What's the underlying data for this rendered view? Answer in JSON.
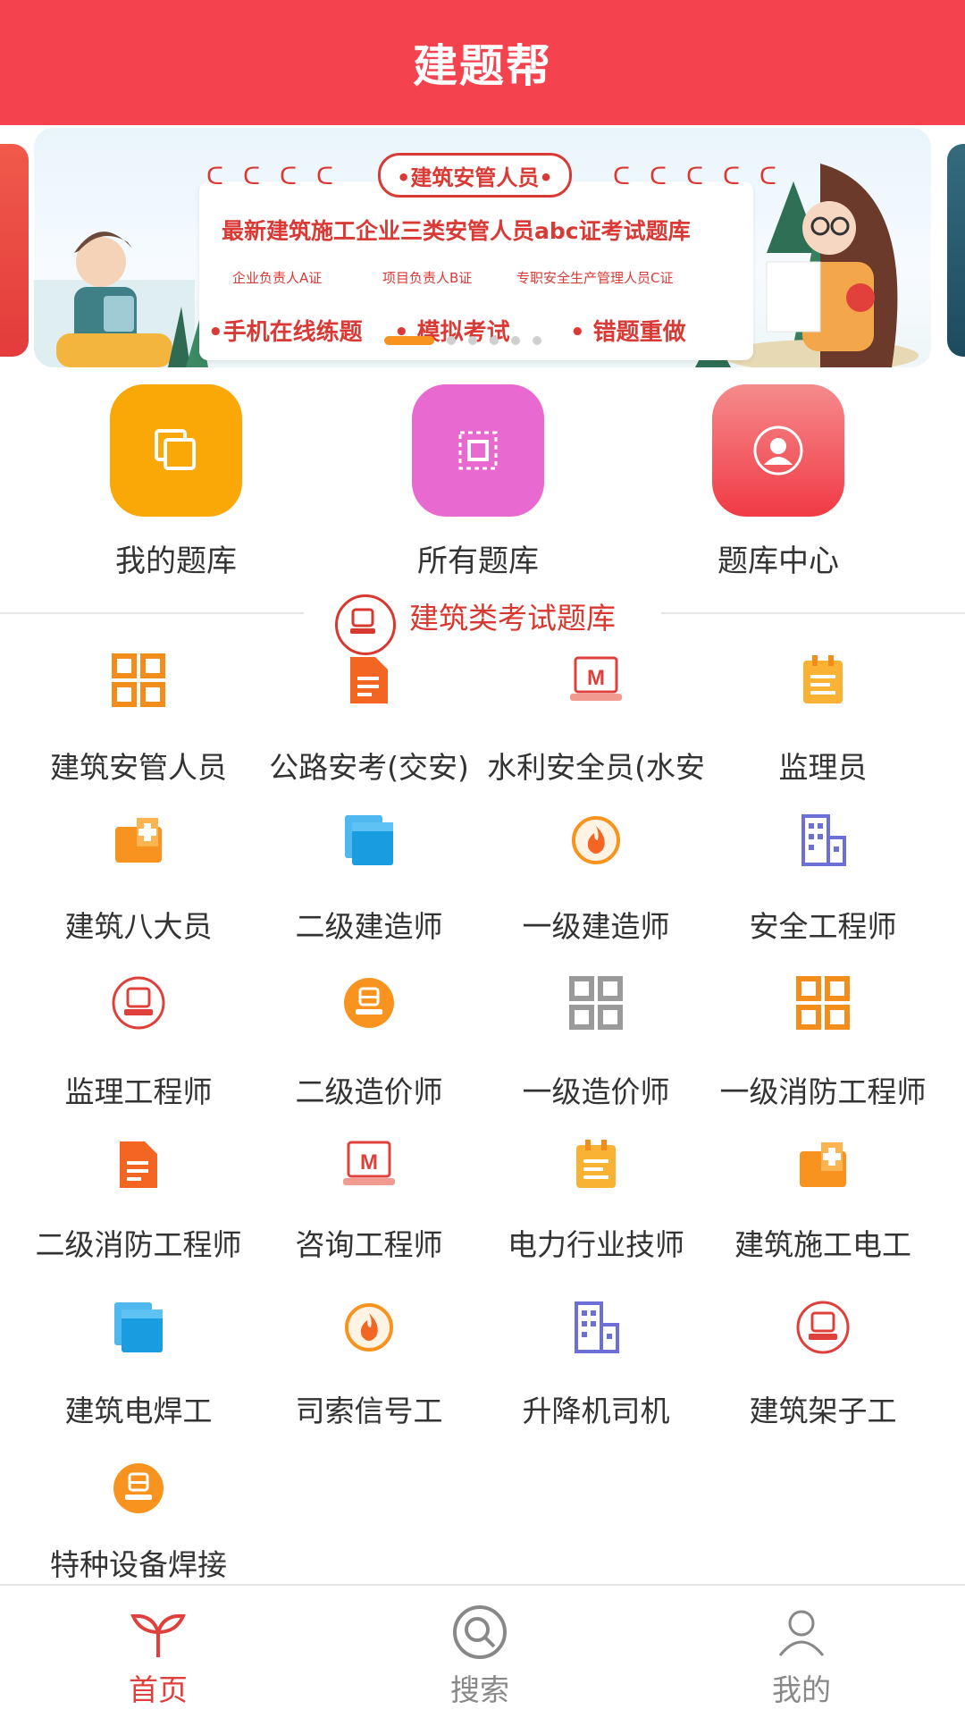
{
  "header": {
    "title": "建题帮"
  },
  "banner": {
    "ribbon": "•建筑安管人员•",
    "title": "最新建筑施工企业三类安管人员abc证考试题库",
    "subs": [
      "企业负责人A证",
      "项目负责人B证",
      "专职安全生产管理人员C证"
    ],
    "features": [
      "•手机在线练题",
      "• 模拟考试",
      "• 错题重做"
    ],
    "active_slide": 1,
    "slide_count": 6
  },
  "quick": [
    {
      "label": "我的题库",
      "icon": "copy-icon",
      "color": "#f9a807"
    },
    {
      "label": "所有题库",
      "icon": "frame-icon",
      "color": "#e86ad0"
    },
    {
      "label": "题库中心",
      "icon": "user-circle-icon",
      "color": "#f3575b"
    }
  ],
  "section": {
    "title": "建筑类考试题库"
  },
  "items": [
    {
      "label": "建筑安管人员",
      "icon": "grid-icon"
    },
    {
      "label": "公路安考(交安)",
      "icon": "document-icon"
    },
    {
      "label": "水利安全员(水安",
      "icon": "certificate-icon"
    },
    {
      "label": "监理员",
      "icon": "clipboard-icon"
    },
    {
      "label": "建筑八大员",
      "icon": "medical-kit-icon"
    },
    {
      "label": "二级建造师",
      "icon": "files-icon"
    },
    {
      "label": "一级建造师",
      "icon": "fire-icon"
    },
    {
      "label": "安全工程师",
      "icon": "building-icon"
    },
    {
      "label": "监理工程师",
      "icon": "badge-icon"
    },
    {
      "label": "二级造价师",
      "icon": "coin-icon"
    },
    {
      "label": "一级造价师",
      "icon": "grid-icon"
    },
    {
      "label": "一级消防工程师",
      "icon": "grid-icon"
    },
    {
      "label": "二级消防工程师",
      "icon": "document-icon"
    },
    {
      "label": "咨询工程师",
      "icon": "certificate-icon"
    },
    {
      "label": "电力行业技师",
      "icon": "clipboard-icon"
    },
    {
      "label": "建筑施工电工",
      "icon": "medical-kit-icon"
    },
    {
      "label": "建筑电焊工",
      "icon": "files-icon"
    },
    {
      "label": "司索信号工",
      "icon": "fire-icon"
    },
    {
      "label": "升降机司机",
      "icon": "building-icon"
    },
    {
      "label": "建筑架子工",
      "icon": "badge-icon"
    },
    {
      "label": "特种设备焊接",
      "icon": "coin-icon"
    }
  ],
  "tabs": [
    {
      "label": "首页",
      "icon": "sprout-icon",
      "active": true
    },
    {
      "label": "搜索",
      "icon": "search-icon",
      "active": false
    },
    {
      "label": "我的",
      "icon": "person-icon",
      "active": false
    }
  ],
  "colors": {
    "primary": "#f4434f",
    "accent": "#d7382f",
    "tab_active": "#e0403b",
    "tab_inactive": "#888888"
  }
}
